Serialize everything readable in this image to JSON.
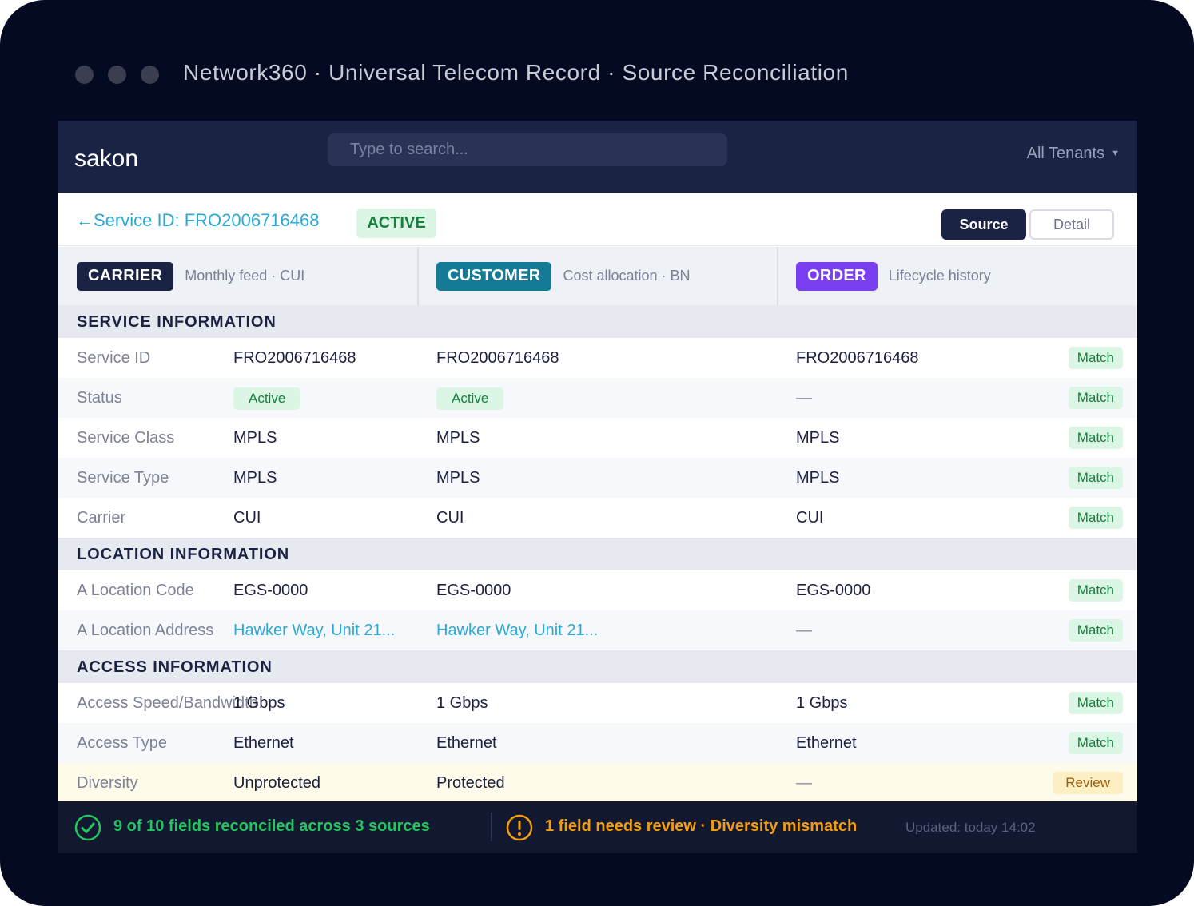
{
  "window": {
    "title": "Network360 · Universal Telecom Record · Source Reconciliation"
  },
  "nav": {
    "logo": "sakon",
    "search_placeholder": "Type to search...",
    "tenant_label": "All Tenants"
  },
  "record": {
    "back_arrow": "←",
    "service_id_label": "Service ID: FRO2006716468",
    "status_badge": "ACTIVE",
    "views": [
      "Source",
      "Detail"
    ],
    "active_view": "Source"
  },
  "sources": [
    {
      "tag": "CARRIER",
      "desc": "Monthly feed · CUI",
      "color": "#1b2344"
    },
    {
      "tag": "CUSTOMER",
      "desc": "Cost allocation · BN",
      "color": "#157a96"
    },
    {
      "tag": "ORDER",
      "desc": "Lifecycle history",
      "color": "#7b3ff2"
    }
  ],
  "sections": [
    {
      "title": "SERVICE INFORMATION",
      "rows": [
        {
          "label": "Service ID",
          "carrier": "FRO2006716468",
          "customer": "FRO2006716468",
          "order": "FRO2006716468",
          "status": "Match"
        },
        {
          "label": "Status",
          "carrier": "Active",
          "customer": "Active",
          "order": "—",
          "status": "Match"
        },
        {
          "label": "Service Class",
          "carrier": "MPLS",
          "customer": "MPLS",
          "order": "MPLS",
          "status": "Match"
        },
        {
          "label": "Service Type",
          "carrier": "MPLS",
          "customer": "MPLS",
          "order": "MPLS",
          "status": "Match"
        },
        {
          "label": "Carrier",
          "carrier": "CUI",
          "customer": "CUI",
          "order": "CUI",
          "status": "Match"
        }
      ]
    },
    {
      "title": "LOCATION INFORMATION",
      "rows": [
        {
          "label": "A Location Code",
          "carrier": "EGS-0000",
          "customer": "EGS-0000",
          "order": "EGS-0000",
          "status": "Match"
        },
        {
          "label": "A Location Address",
          "carrier": "Hawker Way, Unit 21...",
          "customer": "Hawker Way, Unit 21...",
          "order": "—",
          "status": "Match"
        }
      ]
    },
    {
      "title": "ACCESS INFORMATION",
      "rows": [
        {
          "label": "Access Speed/Bandwidth",
          "carrier": "1 Gbps",
          "customer": "1 Gbps",
          "order": "1 Gbps",
          "status": "Match"
        },
        {
          "label": "Access Type",
          "carrier": "Ethernet",
          "customer": "Ethernet",
          "order": "Ethernet",
          "status": "Match"
        },
        {
          "label": "Diversity",
          "carrier": "Unprotected",
          "customer": "Protected",
          "order": "—",
          "status": "Review"
        }
      ]
    }
  ],
  "footer": {
    "ok_text": "9 of 10 fields reconciled across 3 sources",
    "warn_text": "1 field needs review · Diversity mismatch",
    "updated": "Updated: today 14:02"
  },
  "colors": {
    "ok": "#22c55e",
    "warn": "#f59e0b",
    "link": "#29a9d6",
    "review_row_bg": "#fffbea"
  }
}
